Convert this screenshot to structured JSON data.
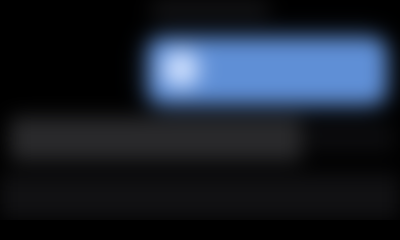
{
  "colors": {
    "background": "#000000",
    "accent_bar": "#5f8fd6",
    "highlight": "#e9f2ff",
    "row_fill": "#2a2a2c",
    "bottom_fill": "#111113"
  },
  "regions": {
    "accent_bar": {
      "icon": "glow-icon"
    },
    "row": {},
    "bottom": {}
  }
}
